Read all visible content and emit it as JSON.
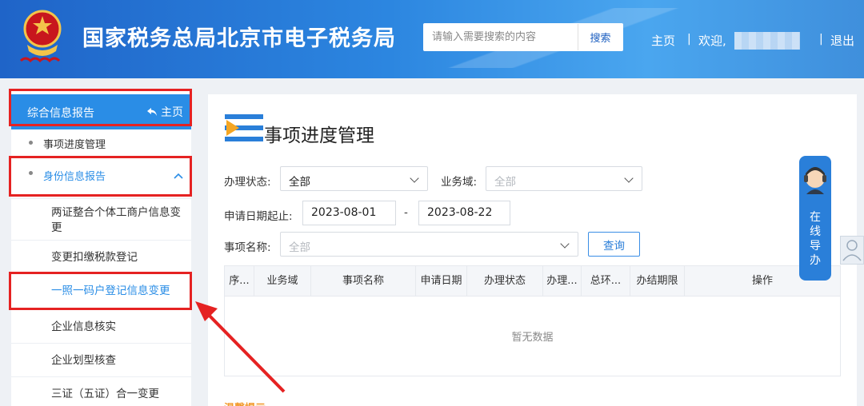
{
  "header": {
    "title": "国家税务总局北京市电子税务局",
    "search_placeholder": "请输入需要搜索的内容",
    "search_button": "搜索",
    "nav_home": "主页",
    "nav_welcome": "欢迎,",
    "nav_logout": "退出",
    "separator": "|"
  },
  "sidebar": {
    "section": "综合信息报告",
    "home_link": "主页",
    "items": [
      {
        "label": "事项进度管理"
      },
      {
        "label": "身份信息报告"
      }
    ],
    "sub_items": [
      {
        "label": "两证整合个体工商户信息变更"
      },
      {
        "label": "变更扣缴税款登记"
      },
      {
        "label": "一照一码户登记信息变更"
      },
      {
        "label": "企业信息核实"
      },
      {
        "label": "企业划型核查"
      },
      {
        "label": "三证（五证）合一变更"
      }
    ]
  },
  "main": {
    "title": "事项进度管理",
    "filters": {
      "status_label": "办理状态:",
      "status_value": "全部",
      "domain_label": "业务域:",
      "domain_value": "全部",
      "date_label": "申请日期起止:",
      "date_from": "2023-08-01",
      "date_sep": "-",
      "date_to": "2023-08-22",
      "name_label": "事项名称:",
      "name_value": "全部",
      "query_button": "查询"
    },
    "table": {
      "columns": [
        "序...",
        "业务域",
        "事项名称",
        "申请日期",
        "办理状态",
        "办理...",
        "总环...",
        "办结期限",
        "操作"
      ],
      "empty_text": "暂无数据"
    },
    "tip": "温馨提示"
  },
  "online_guide": [
    "在",
    "线",
    "导",
    "办"
  ],
  "colors": {
    "header_blue": "#2c86e0",
    "accent_blue": "#2a8de6",
    "highlight_red": "#e52222",
    "tip_orange": "#f29a2c"
  }
}
